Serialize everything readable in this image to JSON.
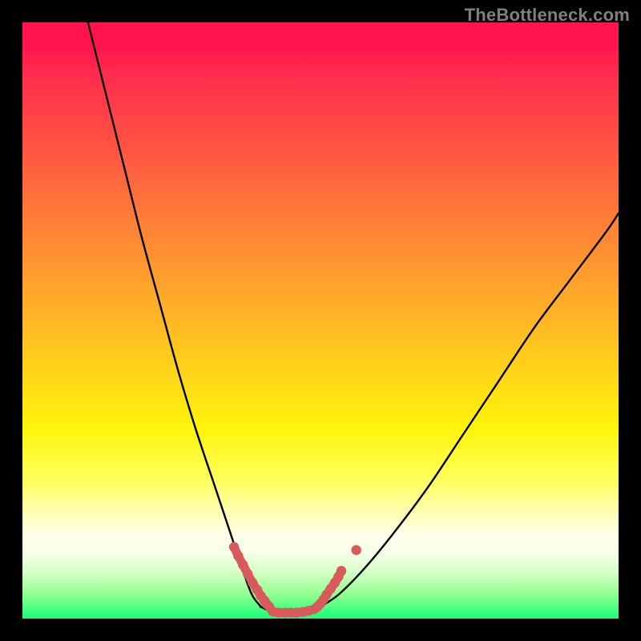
{
  "watermark": "TheBottleneck.com",
  "chart_data": {
    "type": "line",
    "title": "",
    "xlabel": "",
    "ylabel": "",
    "xlim": [
      0,
      100
    ],
    "ylim": [
      0,
      100
    ],
    "grid": false,
    "series": [
      {
        "name": "left-curve",
        "x": [
          11,
          14,
          17,
          20,
          23,
          26,
          29,
          32,
          35,
          37,
          38.5,
          40
        ],
        "y": [
          100,
          88,
          76,
          64,
          53,
          42,
          32,
          23,
          14,
          8,
          4,
          2
        ]
      },
      {
        "name": "valley-floor",
        "x": [
          40,
          42,
          44,
          46,
          48,
          50
        ],
        "y": [
          2,
          1,
          1,
          1,
          1.5,
          2
        ]
      },
      {
        "name": "right-curve",
        "x": [
          50,
          53,
          57,
          62,
          68,
          74,
          80,
          86,
          92,
          98,
          100
        ],
        "y": [
          2,
          4,
          8,
          14,
          22,
          31,
          40,
          49,
          57,
          65,
          68
        ]
      },
      {
        "name": "left-highlight-dots",
        "x": [
          35.5,
          36.2,
          37,
          37.8,
          38.6,
          39.4,
          40,
          40.6,
          41,
          41.4
        ],
        "y": [
          12,
          10.5,
          9,
          7.5,
          6,
          4.8,
          3.8,
          3,
          2.4,
          2
        ]
      },
      {
        "name": "valley-highlight-dots",
        "x": [
          42,
          43,
          44,
          45,
          46,
          47,
          48,
          49
        ],
        "y": [
          1.2,
          1,
          1,
          1,
          1,
          1.1,
          1.3,
          1.6
        ]
      },
      {
        "name": "right-highlight-dots",
        "x": [
          49.5,
          50,
          50.5,
          51,
          51.7,
          52.4,
          53,
          53.5
        ],
        "y": [
          2,
          2.5,
          3.2,
          4,
          5,
          6,
          7,
          8
        ]
      },
      {
        "name": "stray-highlight-dot",
        "x": [
          56
        ],
        "y": [
          11.5
        ]
      }
    ],
    "annotations": [],
    "colors": {
      "curve": "#000000",
      "highlight": "#d85a5a"
    }
  }
}
